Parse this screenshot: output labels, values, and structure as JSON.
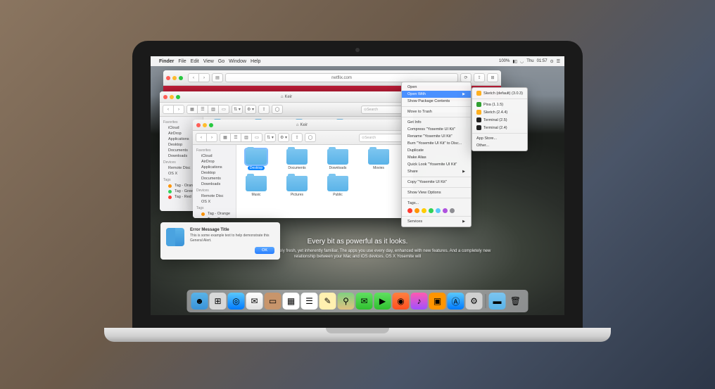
{
  "menubar": {
    "app": "Finder",
    "items": [
      "File",
      "Edit",
      "View",
      "Go",
      "Window",
      "Help"
    ],
    "battery": "100%",
    "day": "Thu",
    "time": "01:57"
  },
  "safari": {
    "url": "netflix.com"
  },
  "finder1": {
    "title": "Keir",
    "search_placeholder": "Search",
    "sidebar": {
      "favorites_h": "Favorites",
      "favorites": [
        "iCloud",
        "AirDrop",
        "Applications",
        "Desktop",
        "Documents",
        "Downloads"
      ],
      "devices_h": "Devices",
      "devices": [
        "Remote Disc",
        "OS X"
      ],
      "tags_h": "Tags",
      "tags": [
        {
          "label": "Tag - Orange",
          "color": "#ff9500"
        },
        {
          "label": "Tag - Green",
          "color": "#30d158"
        },
        {
          "label": "Tag - Red",
          "color": "#ff3b30"
        }
      ]
    }
  },
  "finder2": {
    "title": "Keir",
    "search_placeholder": "Search",
    "sidebar": {
      "favorites_h": "Favorites",
      "favorites": [
        "iCloud",
        "AirDrop",
        "Applications",
        "Desktop",
        "Documents",
        "Downloads"
      ],
      "devices_h": "Devices",
      "devices": [
        "Remote Disc",
        "OS X"
      ],
      "tags_h": "Tags",
      "tags": [
        {
          "label": "Tag - Orange",
          "color": "#ff9500"
        },
        {
          "label": "Tag - Green",
          "color": "#30d158"
        }
      ]
    },
    "folders": [
      "Desktop",
      "Documents",
      "Downloads",
      "Movies",
      "Music",
      "Pictures",
      "Public"
    ],
    "selected": "Desktop"
  },
  "context_menu": {
    "items1": [
      "Open",
      "Open With",
      "Show Package Contents"
    ],
    "highlighted": "Open With",
    "move_trash": "Move to Trash",
    "items2": [
      "Get Info",
      "Compress \"Yosemite UI Kit\"",
      "Rename \"Yosemite UI Kit\"",
      "Burn \"Yosemite UI Kit\" to Disc...",
      "Duplicate",
      "Make Alias",
      "Quick Look \"Yosemite UI Kit\"",
      "Share"
    ],
    "copy": "Copy \"Yosemite UI Kit\"",
    "view_opts": "Show View Options",
    "tags_label": "Tags...",
    "tag_colors": [
      "#ff3b30",
      "#ff9500",
      "#ffcc00",
      "#30d158",
      "#5ac8fa",
      "#af52de",
      "#8e8e93"
    ],
    "services": "Services"
  },
  "submenu": {
    "default": "Sketch (default) (3.0.3)",
    "apps": [
      {
        "name": "Pixa (1.1.5)",
        "color": "#30a030"
      },
      {
        "name": "Sketch (2.4.4)",
        "color": "#ffb020"
      },
      {
        "name": "Terminal (2.5)",
        "color": "#222"
      },
      {
        "name": "Terminal (2.4)",
        "color": "#222"
      }
    ],
    "app_store": "App Store...",
    "other": "Other..."
  },
  "alert": {
    "title": "Error Message Title",
    "text": "This is some example text to help demonstrate this General Alert.",
    "ok": "OK"
  },
  "hero": {
    "title": "Every bit as powerful as it looks.",
    "sub": "elegant design that feels entirely fresh, yet inherently familiar. The apps you use every day, enhanced with new features. And a completely new relationship between your Mac and iOS devices. OS X Yosemite will"
  },
  "dock": {
    "apps": [
      {
        "name": "finder",
        "bg": "linear-gradient(#5ab3e8,#3a93d8)",
        "glyph": "☻"
      },
      {
        "name": "launchpad",
        "bg": "#d8d8d8",
        "glyph": "⊞"
      },
      {
        "name": "safari",
        "bg": "linear-gradient(#5ac8fa,#007aff)",
        "glyph": "◎"
      },
      {
        "name": "mail",
        "bg": "linear-gradient(#fff,#e0e0e0)",
        "glyph": "✉"
      },
      {
        "name": "contacts",
        "bg": "#c8956b",
        "glyph": "▭"
      },
      {
        "name": "calendar",
        "bg": "#fff",
        "glyph": "▦"
      },
      {
        "name": "reminders",
        "bg": "#fff",
        "glyph": "☰"
      },
      {
        "name": "notes",
        "bg": "#fff0b0",
        "glyph": "✎"
      },
      {
        "name": "maps",
        "bg": "linear-gradient(#80d080,#e0c080)",
        "glyph": "⚲"
      },
      {
        "name": "messages",
        "bg": "linear-gradient(#60e060,#30c030)",
        "glyph": "✉"
      },
      {
        "name": "facetime",
        "bg": "linear-gradient(#60e060,#30c030)",
        "glyph": "▶"
      },
      {
        "name": "photobooth",
        "bg": "linear-gradient(#ff8040,#ff5020)",
        "glyph": "◉"
      },
      {
        "name": "itunes",
        "bg": "linear-gradient(#ff5ab0,#a050ff)",
        "glyph": "♪"
      },
      {
        "name": "ibooks",
        "bg": "#ff9500",
        "glyph": "▣"
      },
      {
        "name": "appstore",
        "bg": "linear-gradient(#5ac8fa,#007aff)",
        "glyph": "Ⓐ"
      },
      {
        "name": "preferences",
        "bg": "#d0d0d0",
        "glyph": "⚙"
      }
    ],
    "right": [
      {
        "name": "folder",
        "bg": "linear-gradient(#7cc5f0,#5ab3e8)",
        "glyph": "▬"
      },
      {
        "name": "trash",
        "bg": "transparent",
        "glyph": "🗑"
      }
    ]
  }
}
